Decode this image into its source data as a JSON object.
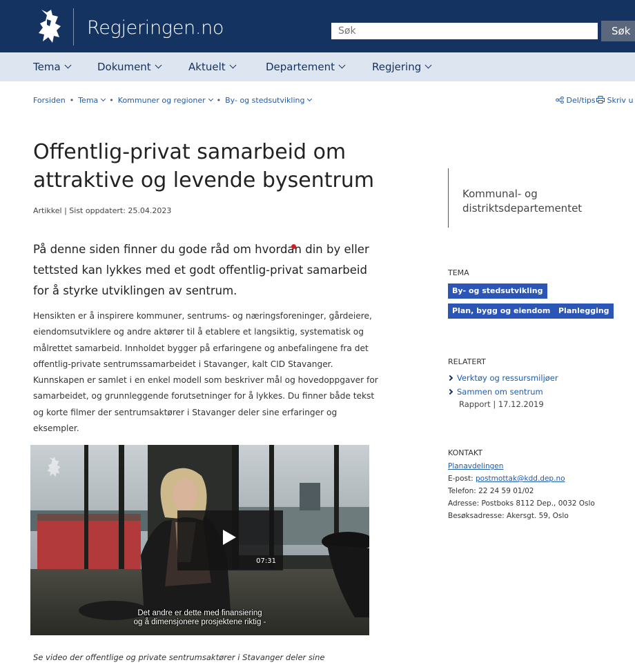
{
  "header": {
    "site_title": "Regjeringen.no",
    "search_placeholder": "Søk",
    "search_button": "Søk",
    "brand_color": "#143360"
  },
  "nav": {
    "items": [
      {
        "label": "Tema"
      },
      {
        "label": "Dokument"
      },
      {
        "label": "Aktuelt"
      },
      {
        "label": "Departement"
      },
      {
        "label": "Regjering"
      }
    ]
  },
  "breadcrumb": {
    "items": [
      "Forsiden",
      "Tema",
      "Kommuner og regioner",
      "By- og stedsutvikling"
    ],
    "share": "Del/tips",
    "print": "Skriv u"
  },
  "article": {
    "title": "Offentlig-privat samarbeid om attraktive og levende bysentrum",
    "meta": "Artikkel | Sist oppdatert: 25.04.2023",
    "lead": "På denne siden finner du gode råd om hvordan din by eller tettsted kan lykkes med et godt offentlig-privat samarbeid for å styrke utviklingen av sentrum.",
    "body": "Hensikten er å inspirere kommuner, sentrums- og næringsforeninger, gårdeiere, eiendomsutviklere og andre aktører til å etablere et langsiktig, systematisk og målrettet samarbeid. Innholdet bygger på erfaringene og anbefalingene fra det offentlig-private sentrumssamarbeidet i Stavanger, kalt CID Stavanger. Kunnskapen er samlet i en enkel modell som beskriver mål og hovedoppgaver for samarbeidet, og grunnleggende forutsetninger for å lykkes. Du finner både tekst og korte filmer der sentrumsaktører i Stavanger deler sine erfaringer og eksempler.",
    "video": {
      "duration": "07:31",
      "subtitle_line1": "Det andre er dette med finansiering",
      "subtitle_line2": "og å dimensjonere prosjektene riktig -"
    },
    "caption": "Se video der offentlige og private sentrumsaktører i Stavanger deler sine"
  },
  "sidebar": {
    "department": "Kommunal- og distriktsdepartementet",
    "tema_heading": "TEMA",
    "tags": [
      "By- og stedsutvikling",
      "Plan, bygg og eiendom",
      "Planlegging"
    ],
    "tag_color": "#2b56b8",
    "relatert_heading": "RELATERT",
    "related": [
      {
        "title": "Verktøy og ressursmiljøer"
      },
      {
        "title": "Sammen om sentrum",
        "sub": "Rapport | 17.12.2019"
      }
    ],
    "kontakt_heading": "KONTAKT",
    "contact": {
      "name": "Planavdelingen",
      "email_label": "E-post:",
      "email": "postmottak@kdd.dep.no",
      "phone": "Telefon: 22 24 59 01/02",
      "address": "Adresse: Postboks 8112 Dep., 0032 Oslo",
      "visit": "Besøksadresse: Akersgt. 59, Oslo"
    }
  }
}
